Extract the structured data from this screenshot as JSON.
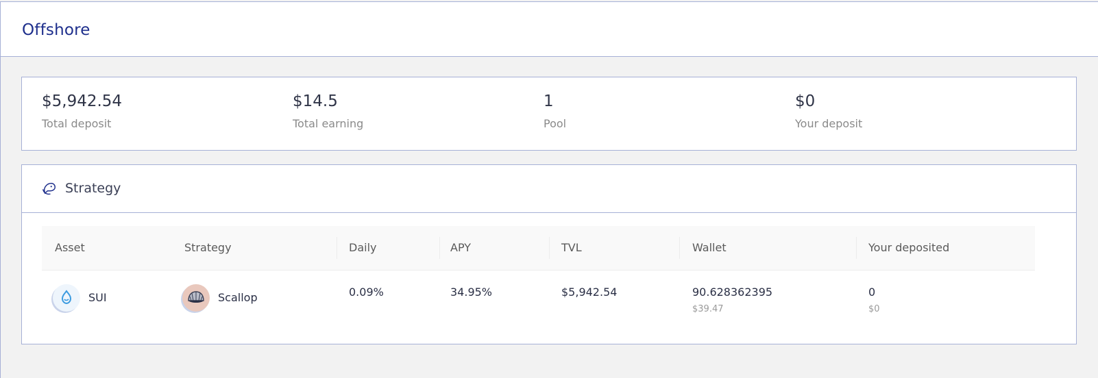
{
  "header": {
    "title": "Offshore"
  },
  "stats": [
    {
      "value": "$5,942.54",
      "label": "Total deposit"
    },
    {
      "value": "$14.5",
      "label": "Total earning"
    },
    {
      "value": "1",
      "label": "Pool"
    },
    {
      "value": "$0",
      "label": "Your deposit"
    }
  ],
  "strategy_section": {
    "title": "Strategy",
    "columns": [
      "Asset",
      "Strategy",
      "Daily",
      "APY",
      "TVL",
      "Wallet",
      "Your deposited"
    ],
    "rows": [
      {
        "asset": "SUI",
        "strategy": "Scallop",
        "daily": "0.09%",
        "apy": "34.95%",
        "tvl": "$5,942.54",
        "wallet": "90.628362395",
        "wallet_usd": "$39.47",
        "deposited": "0",
        "deposited_usd": "$0"
      }
    ]
  },
  "colors": {
    "accent": "#1e2f8c",
    "border": "#a6b0d6"
  }
}
